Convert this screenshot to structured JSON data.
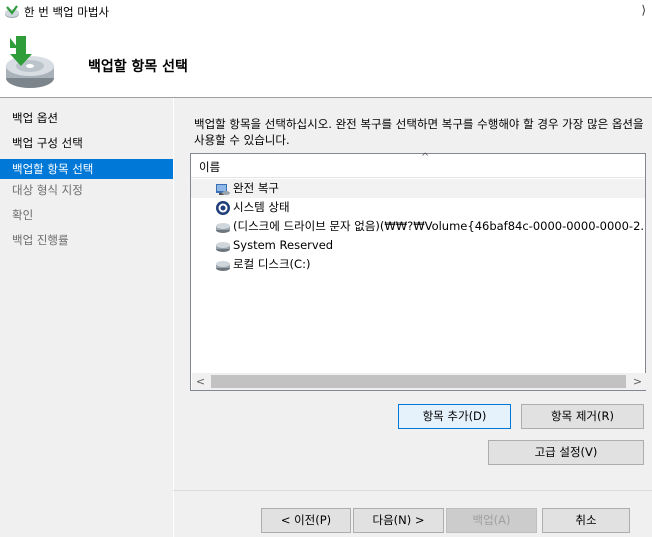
{
  "window": {
    "title": "한 번 백업 마법사",
    "chevron": "⟩"
  },
  "header": {
    "title": "백업할 항목 선택"
  },
  "sidebar": {
    "items": [
      {
        "label": "백업 옵션",
        "state": "normal"
      },
      {
        "label": "백업 구성 선택",
        "state": "normal"
      },
      {
        "label": "백업할 항목 선택",
        "state": "active"
      },
      {
        "label": "대상 형식 지정",
        "state": "disabled"
      },
      {
        "label": "확인",
        "state": "disabled"
      },
      {
        "label": "백업 진행률",
        "state": "disabled"
      }
    ]
  },
  "main": {
    "instruction": "백업할 항목을 선택하십시오. 완전 복구를 선택하면 복구를 수행해야 할 경우 가장 많은 옵션을 사용할 수 있습니다."
  },
  "list": {
    "column_header": "이름",
    "sort_glyph": "^",
    "items": [
      {
        "label": "완전 복구",
        "icon": "bare-metal-recovery-icon"
      },
      {
        "label": "시스템 상태",
        "icon": "system-state-icon"
      },
      {
        "label": "(디스크에 드라이브 문자 없음)(₩₩?₩Volume{46baf84c-0000-0000-0000-2...",
        "icon": "drive-icon"
      },
      {
        "label": "System Reserved",
        "icon": "drive-icon"
      },
      {
        "label": "로컬 디스크(C:)",
        "icon": "drive-icon"
      }
    ],
    "scroll_left": "<",
    "scroll_right": ">"
  },
  "buttons": {
    "add_items": "항목 추가(D)",
    "remove_items": "항목 제거(R)",
    "advanced": "고급 설정(V)",
    "previous": "< 이전(P)",
    "next": "다음(N) >",
    "backup": "백업(A)",
    "cancel": "취소"
  },
  "colors": {
    "accent": "#0078d7",
    "panel": "#f0f0f0"
  }
}
